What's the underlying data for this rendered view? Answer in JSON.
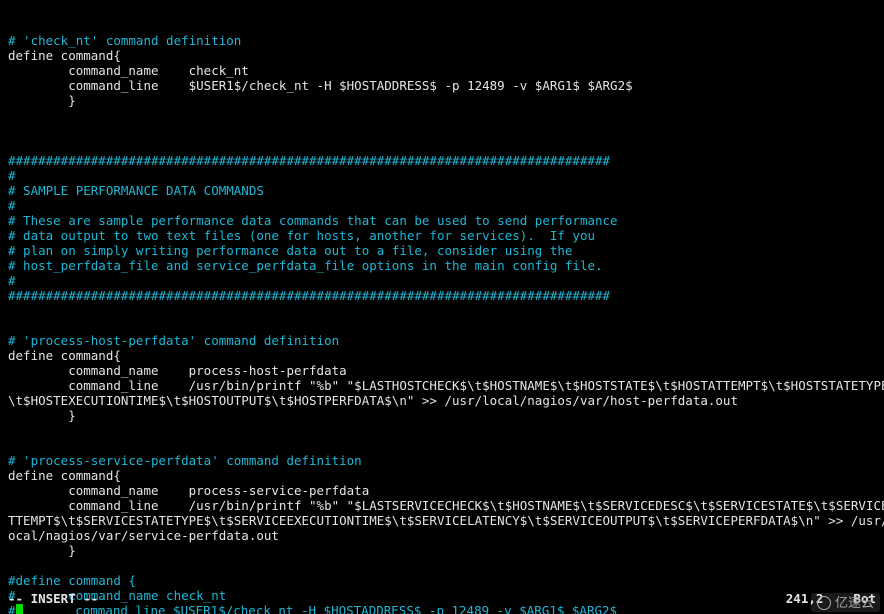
{
  "lines": [
    {
      "cls": "cyan",
      "text": "# 'check_nt' command definition"
    },
    {
      "cls": "white",
      "text": "define command{"
    },
    {
      "cls": "white",
      "text": "        command_name    check_nt"
    },
    {
      "cls": "white",
      "text": "        command_line    $USER1$/check_nt -H $HOSTADDRESS$ -p 12489 -v $ARG1$ $ARG2$"
    },
    {
      "cls": "white",
      "text": "        }"
    },
    {
      "cls": "white",
      "text": ""
    },
    {
      "cls": "white",
      "text": ""
    },
    {
      "cls": "white",
      "text": ""
    },
    {
      "cls": "cyan",
      "text": "################################################################################"
    },
    {
      "cls": "cyan",
      "text": "#"
    },
    {
      "cls": "cyan",
      "text": "# SAMPLE PERFORMANCE DATA COMMANDS"
    },
    {
      "cls": "cyan",
      "text": "#"
    },
    {
      "cls": "cyan",
      "text": "# These are sample performance data commands that can be used to send performance"
    },
    {
      "cls": "cyan",
      "text": "# data output to two text files (one for hosts, another for services).  If you"
    },
    {
      "cls": "cyan",
      "text": "# plan on simply writing performance data out to a file, consider using the"
    },
    {
      "cls": "cyan",
      "text": "# host_perfdata_file and service_perfdata_file options in the main config file."
    },
    {
      "cls": "cyan",
      "text": "#"
    },
    {
      "cls": "cyan",
      "text": "################################################################################"
    },
    {
      "cls": "white",
      "text": ""
    },
    {
      "cls": "white",
      "text": ""
    },
    {
      "cls": "cyan",
      "text": "# 'process-host-perfdata' command definition"
    },
    {
      "cls": "white",
      "text": "define command{"
    },
    {
      "cls": "white",
      "text": "        command_name    process-host-perfdata"
    },
    {
      "cls": "white",
      "text": "        command_line    /usr/bin/printf \"%b\" \"$LASTHOSTCHECK$\\t$HOSTNAME$\\t$HOSTSTATE$\\t$HOSTATTEMPT$\\t$HOSTSTATETYPE$\\t$HOSTEXECUTIONTIME$\\t$HOSTOUTPUT$\\t$HOSTPERFDATA$\\n\" >> /usr/local/nagios/var/host-perfdata.out"
    },
    {
      "cls": "white",
      "text": "        }"
    },
    {
      "cls": "white",
      "text": ""
    },
    {
      "cls": "white",
      "text": ""
    },
    {
      "cls": "cyan",
      "text": "# 'process-service-perfdata' command definition"
    },
    {
      "cls": "white",
      "text": "define command{"
    },
    {
      "cls": "white",
      "text": "        command_name    process-service-perfdata"
    },
    {
      "cls": "white",
      "text": "        command_line    /usr/bin/printf \"%b\" \"$LASTSERVICECHECK$\\t$HOSTNAME$\\t$SERVICEDESC$\\t$SERVICESTATE$\\t$SERVICEATTEMPT$\\t$SERVICESTATETYPE$\\t$SERVICEEXECUTIONTIME$\\t$SERVICELATENCY$\\t$SERVICEOUTPUT$\\t$SERVICEPERFDATA$\\n\" >> /usr/local/nagios/var/service-perfdata.out"
    },
    {
      "cls": "white",
      "text": "        }"
    },
    {
      "cls": "white",
      "text": ""
    },
    {
      "cls": "cyan",
      "text": "#define command {"
    },
    {
      "cls": "cyan",
      "text": "#       command_name check_nt"
    },
    {
      "cls": "cyan",
      "text": "#       command_line $USER1$/check_nt -H $HOSTADDRESS$ -p 12489 -v $ARG1$ $ARG2$",
      "cursor_after_hash": true
    }
  ],
  "status": {
    "mode": "-- INSERT --",
    "pos": "241,2",
    "scroll": "Bot"
  },
  "watermark": "亿速云",
  "wrap_width": 118
}
